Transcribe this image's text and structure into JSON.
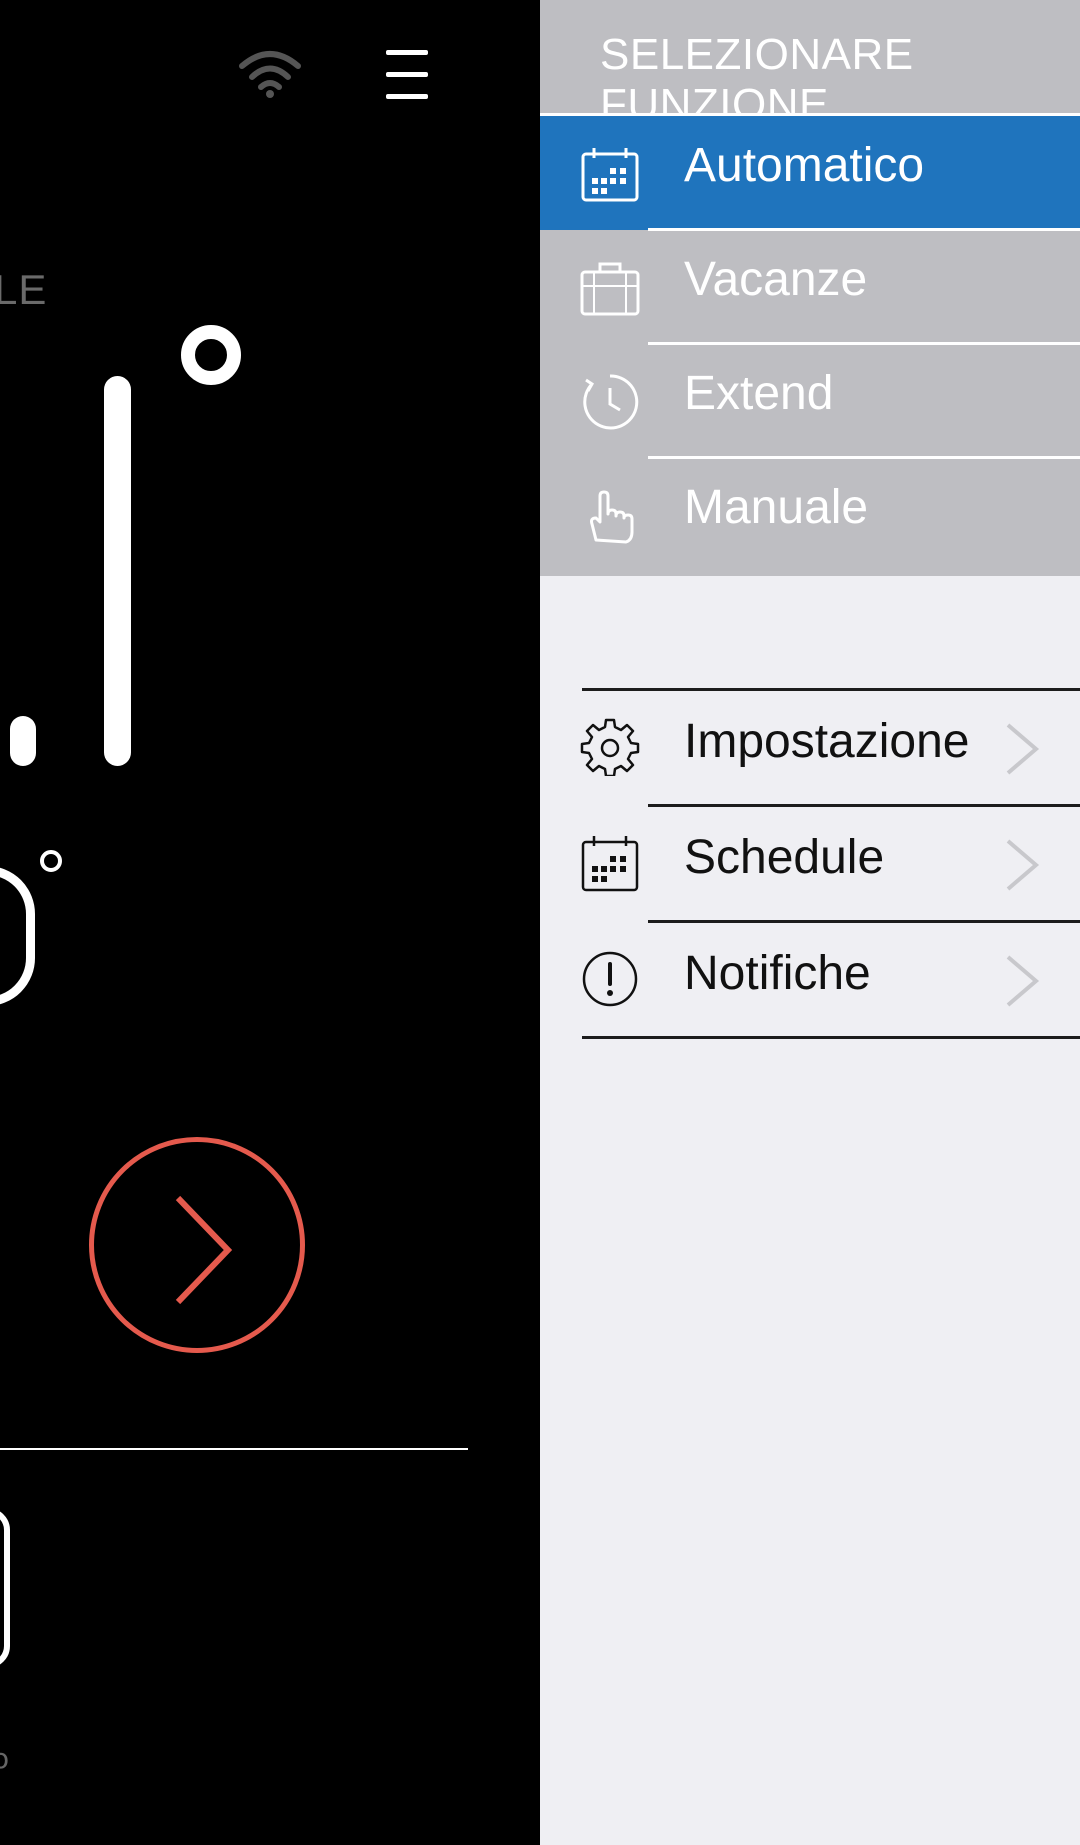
{
  "left_screen": {
    "mode_label_partial": "LE",
    "bottom_text_partial": "o",
    "accent_color": "#e55a4d"
  },
  "drawer": {
    "header": {
      "title": "SELEZIONARE FUNZIONE"
    },
    "modes": [
      {
        "label": "Automatico",
        "icon": "calendar-icon",
        "active": true
      },
      {
        "label": "Vacanze",
        "icon": "suitcase-icon",
        "active": false
      },
      {
        "label": "Extend",
        "icon": "clock-icon",
        "active": false
      },
      {
        "label": "Manuale",
        "icon": "hand-pointer-icon",
        "active": false
      }
    ],
    "settings": [
      {
        "label": "Impostazione",
        "icon": "gear-icon"
      },
      {
        "label": "Schedule",
        "icon": "calendar-icon"
      },
      {
        "label": "Notifiche",
        "icon": "alert-icon"
      }
    ],
    "active_color": "#1f74bd"
  }
}
